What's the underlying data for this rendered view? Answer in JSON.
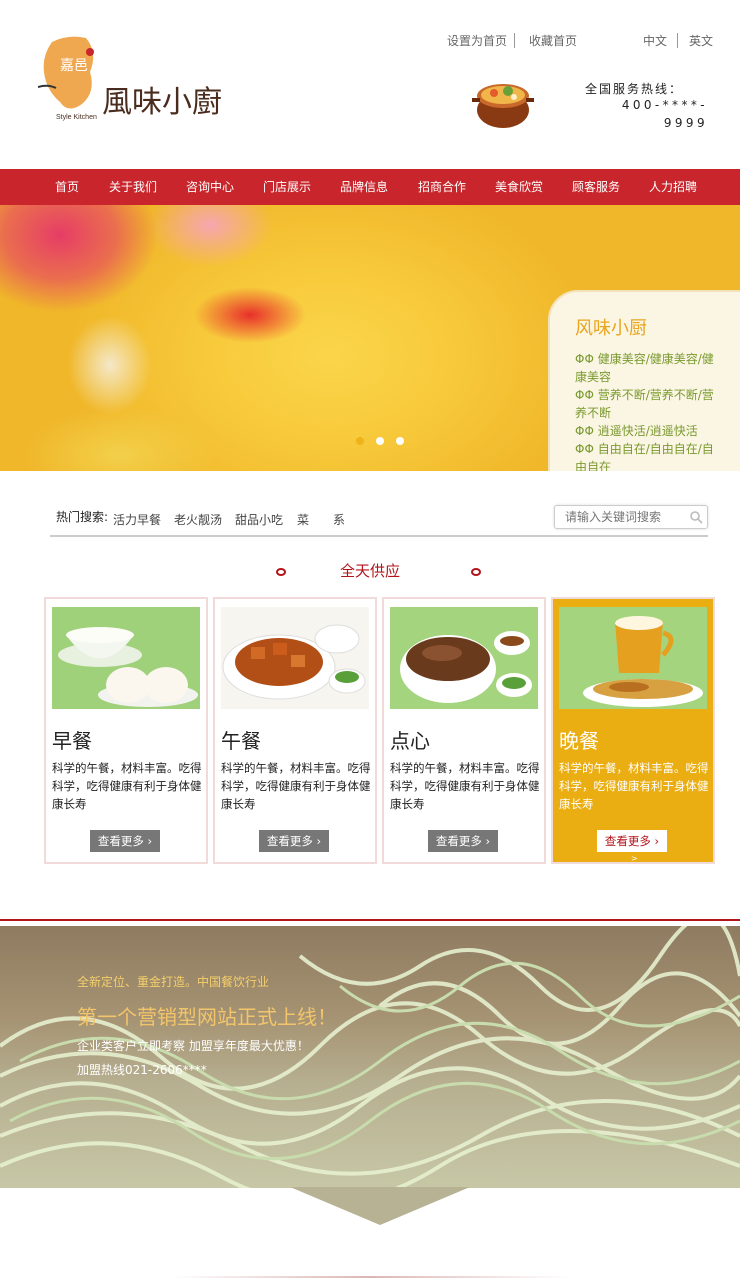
{
  "header": {
    "logo_text_main": "風味小廚",
    "logo_text_sub": "Style Kitchen",
    "logo_badge": "嘉邑",
    "top_links": {
      "set_home": "设置为首页",
      "favorite": "收藏首页",
      "chinese": "中文",
      "english": "英文"
    },
    "hotline_label": "全国服务热线：",
    "hotline_number": "400-****-9999"
  },
  "nav": {
    "items": [
      "首页",
      "关于我们",
      "咨询中心",
      "门店展示",
      "品牌信息",
      "招商合作",
      "美食欣赏",
      "顾客服务",
      "人力招聘"
    ]
  },
  "banner": {
    "title": "风味小厨",
    "lines": [
      "ΦΦ  健康美容/健康美容/健康美容",
      "ΦΦ  营养不断/营养不断/营养不断",
      "ΦΦ  逍遥快活/逍遥快活",
      "ΦΦ  自由自在/自由自在/自由自在"
    ],
    "slides": 3,
    "active_slide": 1
  },
  "search": {
    "hot_label": "热门搜索:",
    "hot_words": [
      "活力早餐",
      "老火靓汤",
      "甜品小吃",
      "菜",
      "系"
    ],
    "placeholder": "请输入关键词搜索"
  },
  "section": {
    "title": "全天供应"
  },
  "cards": [
    {
      "title": "早餐",
      "desc": "科学的午餐，材料丰富。吃得科学，吃得健康有利于身体健康长寿",
      "button": "查看更多 ›"
    },
    {
      "title": "午餐",
      "desc": "科学的午餐，材料丰富。吃得科学，吃得健康有利于身体健康长寿",
      "button": "查看更多 ›"
    },
    {
      "title": "点心",
      "desc": "科学的午餐，材料丰富。吃得科学，吃得健康有利于身体健康长寿",
      "button": "查看更多 ›"
    },
    {
      "title": "晚餐",
      "desc": "科学的午餐，材料丰富。吃得科学，吃得健康有利于身体健康长寿",
      "button": "查看更多 ›",
      "extra": ">"
    }
  ],
  "promo": {
    "subtitle": "全新定位、重金打造。中国餐饮行业",
    "title": "第一个营销型网站正式上线！",
    "line1": "企业类客户立即考察 加盟享年度最大优惠！",
    "line2": "加盟热线021-2606****"
  },
  "colors": {
    "nav_bg": "#c8262c",
    "accent_red": "#b3141b",
    "featured_card": "#ebae12",
    "banner_title": "#e9a51c"
  }
}
